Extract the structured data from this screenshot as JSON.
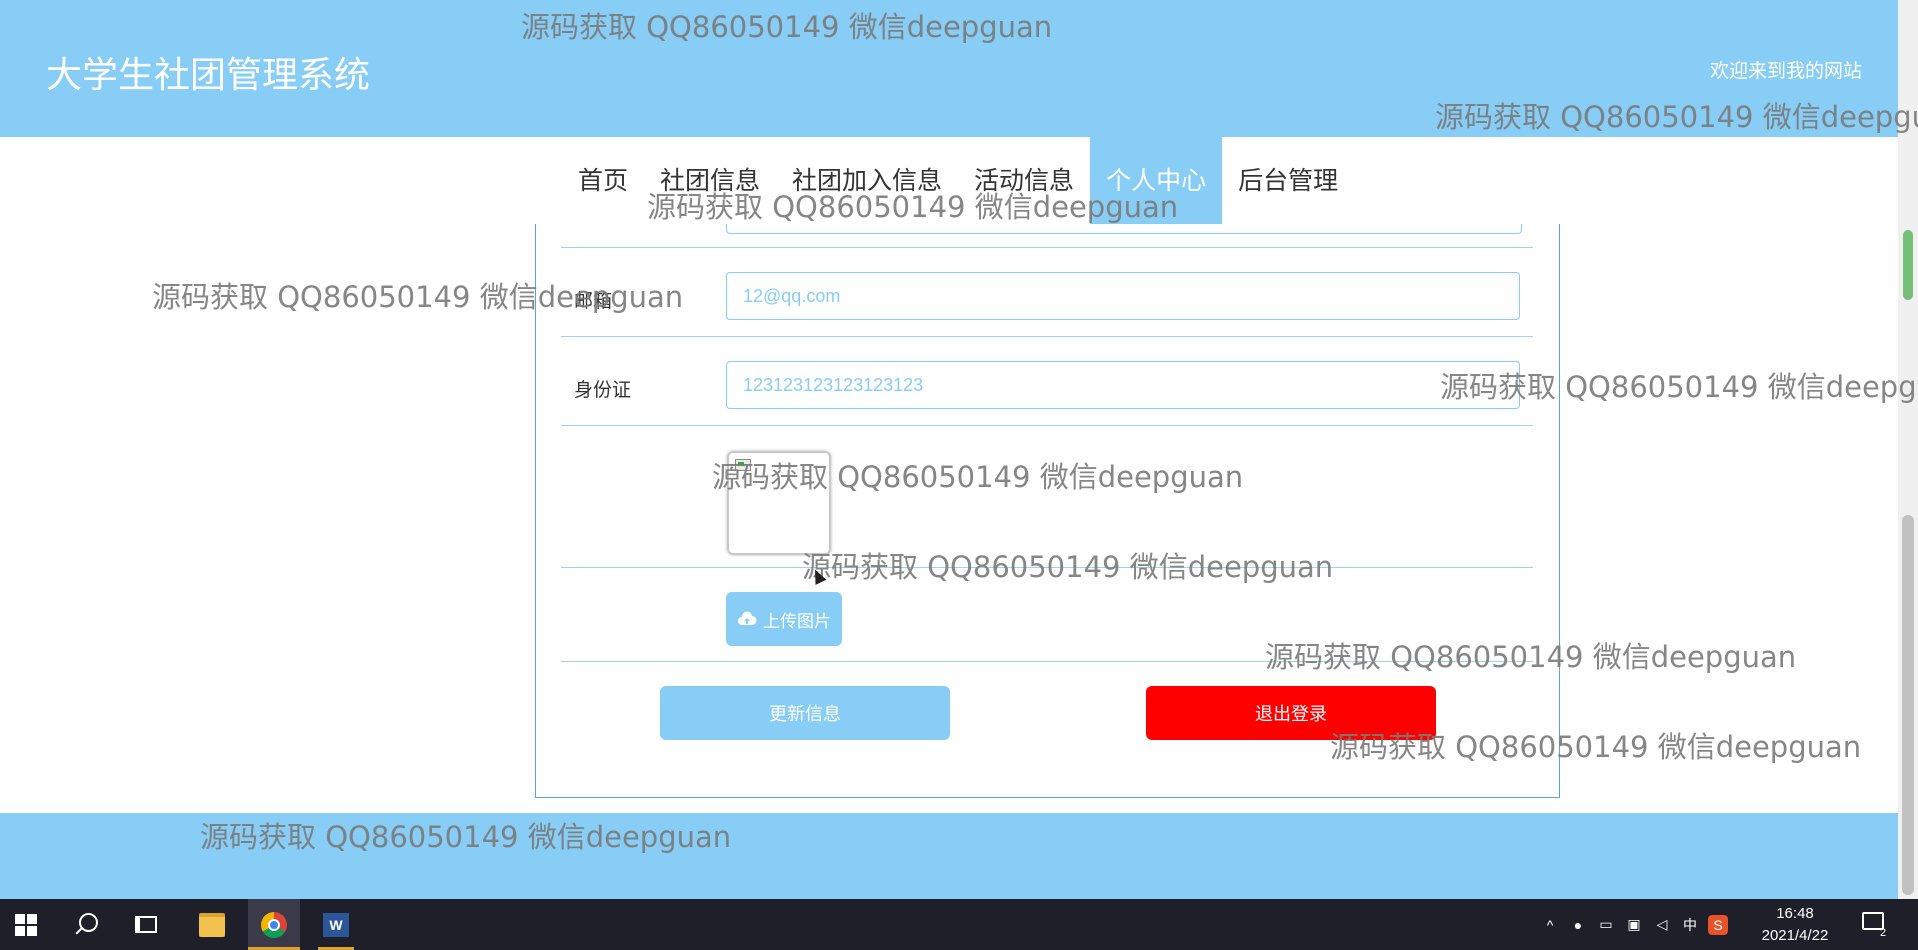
{
  "header": {
    "site_title": "大学生社团管理系统",
    "welcome": "欢迎来到我的网站"
  },
  "nav": {
    "items": [
      {
        "label": "首页",
        "active": false
      },
      {
        "label": "社团信息",
        "active": false
      },
      {
        "label": "社团加入信息",
        "active": false
      },
      {
        "label": "活动信息",
        "active": false
      },
      {
        "label": "个人中心",
        "active": true
      },
      {
        "label": "后台管理",
        "active": false
      }
    ]
  },
  "form": {
    "email_label": "邮箱",
    "email_value": "12@qq.com",
    "id_card_label": "身份证",
    "id_card_value": "123123123123123123",
    "upload_label": "上传图片",
    "update_label": "更新信息",
    "logout_label": "退出登录"
  },
  "watermark": {
    "text": "源码获取 QQ86050149 微信deepguan"
  },
  "taskbar": {
    "tray_ime": "中",
    "clock_time": "16:48",
    "clock_date": "2021/4/22",
    "notification_count": "2"
  },
  "colors": {
    "brand": "#87cdf6",
    "danger": "#ff0000",
    "taskbar": "#1f1f2a"
  }
}
